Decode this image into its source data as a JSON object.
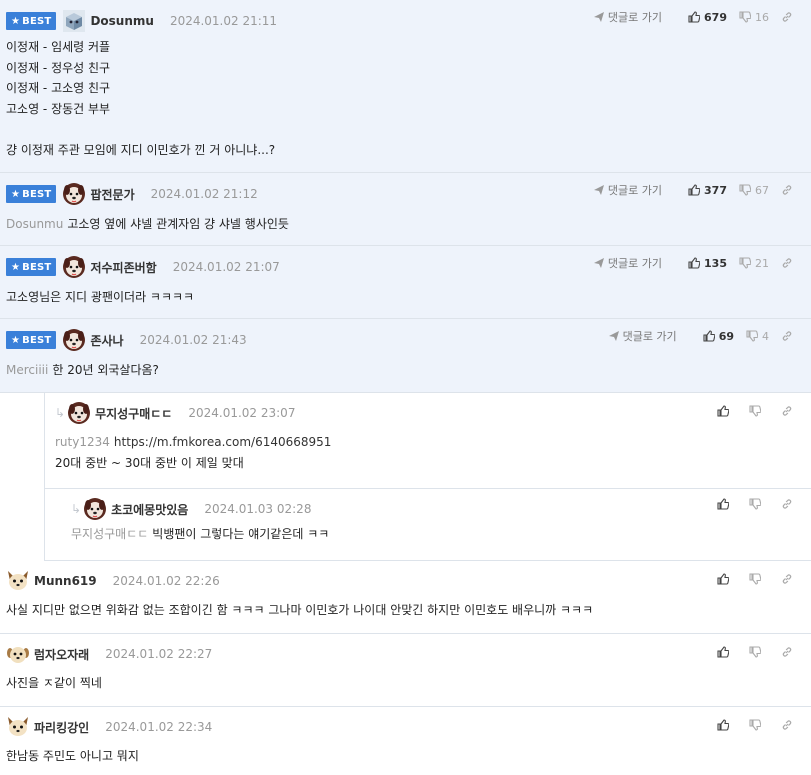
{
  "labels": {
    "best": "BEST",
    "reply_to": "댓글로 가기"
  },
  "colors": {
    "best_badge": "#3a80d9",
    "best_background": "#eef3fb",
    "border": "#dde3ea"
  },
  "comments": [
    {
      "nick": "Dosunmu",
      "date": "2024.01.02 21:11",
      "avatar": "cube-avatar-icon",
      "up": "679",
      "down": "16",
      "lines": [
        "이정재 - 임세령 커플",
        "이정재 - 정우성 친구",
        "이정재 - 고소영 친구",
        "고소영 - 장동건 부부",
        "",
        "걍 이정재 주관 모임에 지디 이민호가 낀 거 아니냐...?"
      ]
    },
    {
      "nick": "팝전문가",
      "date": "2024.01.02 21:12",
      "avatar": "dog-avatar-icon",
      "up": "377",
      "down": "67",
      "mention": "Dosunmu",
      "lines": [
        "고소영 옆에 샤넬 관계자임 걍 샤넬 행사인듯"
      ]
    },
    {
      "nick": "저수피존버함",
      "date": "2024.01.02 21:07",
      "avatar": "dog-avatar-icon",
      "up": "135",
      "down": "21",
      "lines": [
        "고소영님은 지디 광팬이더라 ㅋㅋㅋㅋ"
      ]
    },
    {
      "nick": "존사나",
      "date": "2024.01.02 21:43",
      "avatar": "dog-avatar-icon",
      "up": "69",
      "down": "4",
      "mention": "Merciiii",
      "lines": [
        "한 20년 외국살다옴?"
      ]
    },
    {
      "nick": "무지성구매ㄷㄷ",
      "date": "2024.01.02 23:07",
      "avatar": "dog-avatar-icon",
      "mention": "ruty1234",
      "link": "https://m.fmkorea.com/6140668951",
      "lines": [
        "20대 중반 ~ 30대 중반 이 제일 맞대"
      ]
    },
    {
      "nick": "초코에몽맛있음",
      "date": "2024.01.03 02:28",
      "avatar": "dog-avatar-icon",
      "mention": "무지성구매ㄷㄷ",
      "lines": [
        "빅뱅팬이 그렇다는 얘기같은데 ㅋㅋ"
      ]
    },
    {
      "nick": "Munn619",
      "date": "2024.01.02 22:26",
      "avatar": "fox-avatar-icon",
      "lines": [
        "사실 지디만 없으면 위화감 없는 조합이긴 함 ㅋㅋㅋ 그나마 이민호가 나이대 안맞긴 하지만 이민호도 배우니까 ㅋㅋㅋ"
      ]
    },
    {
      "nick": "럼자오자래",
      "date": "2024.01.02 22:27",
      "avatar": "puppy-avatar-icon",
      "lines": [
        "사진을 ㅈ같이 찍네"
      ]
    },
    {
      "nick": "파리킹강인",
      "date": "2024.01.02 22:34",
      "avatar": "fox-avatar-icon",
      "lines": [
        "한남동 주민도 아니고 뭐지"
      ]
    }
  ]
}
